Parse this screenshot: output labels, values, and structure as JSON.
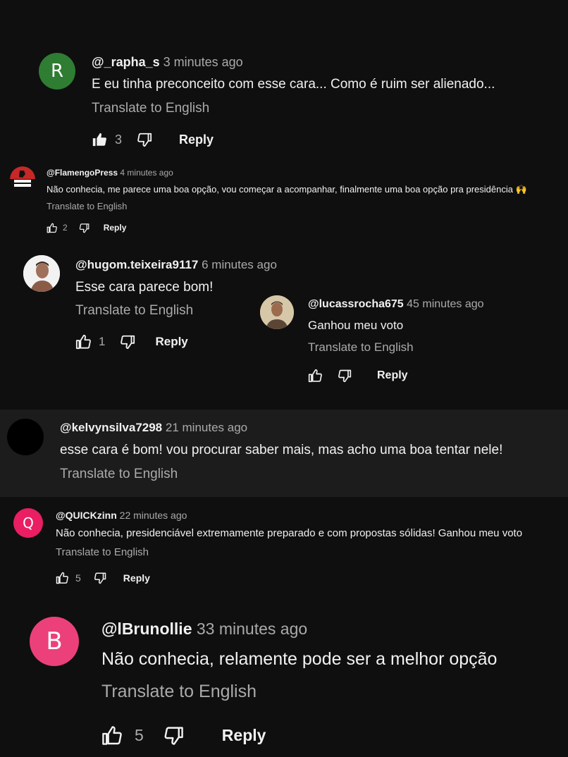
{
  "comments": [
    {
      "author": "@_rapha_s",
      "time": "3 minutes ago",
      "text": "E eu tinha preconceito com esse cara... Como é ruim ser alienado...",
      "translate": "Translate to English",
      "likes": "3",
      "reply": "Reply",
      "avatar_letter": "R",
      "avatar_color": "#2e7d32"
    },
    {
      "author": "@FlamengoPress",
      "time": "4 minutes ago",
      "text": "Não conhecia, me parece uma boa opção, vou começar a acompanhar, finalmente uma boa opção pra presidência 🙌",
      "translate": "Translate to English",
      "likes": "2",
      "reply": "Reply",
      "avatar_text": "FLA PRESS",
      "avatar_color": "#c62828"
    },
    {
      "author": "@hugom.teixeira9117",
      "time": "6 minutes ago",
      "text": "Esse cara parece bom!",
      "translate": "Translate to English",
      "likes": "1",
      "reply": "Reply"
    },
    {
      "author": "@lucassrocha675",
      "time": "45 minutes ago",
      "text": "Ganhou meu voto",
      "translate": "Translate to English",
      "reply": "Reply"
    },
    {
      "author": "@kelvynsilva7298",
      "time": "21 minutes ago",
      "text": "esse cara é bom! vou procurar saber mais, mas acho uma boa tentar nele!",
      "translate": "Translate to English",
      "avatar_color": "#000000"
    },
    {
      "author": "@QUICKzinn",
      "time": "22 minutes ago",
      "text": "Não conhecia, presidenciável extremamente preparado e com propostas sólidas! Ganhou meu voto",
      "translate": "Translate to English",
      "likes": "5",
      "reply": "Reply",
      "avatar_letter": "Q",
      "avatar_color": "#e91e63"
    },
    {
      "author": "@lBrunollie",
      "time": "33 minutes ago",
      "text": "Não conhecia, relamente pode ser a melhor opção",
      "translate": "Translate to English",
      "likes": "5",
      "reply": "Reply",
      "avatar_letter": "B",
      "avatar_color": "#ec407a"
    }
  ]
}
